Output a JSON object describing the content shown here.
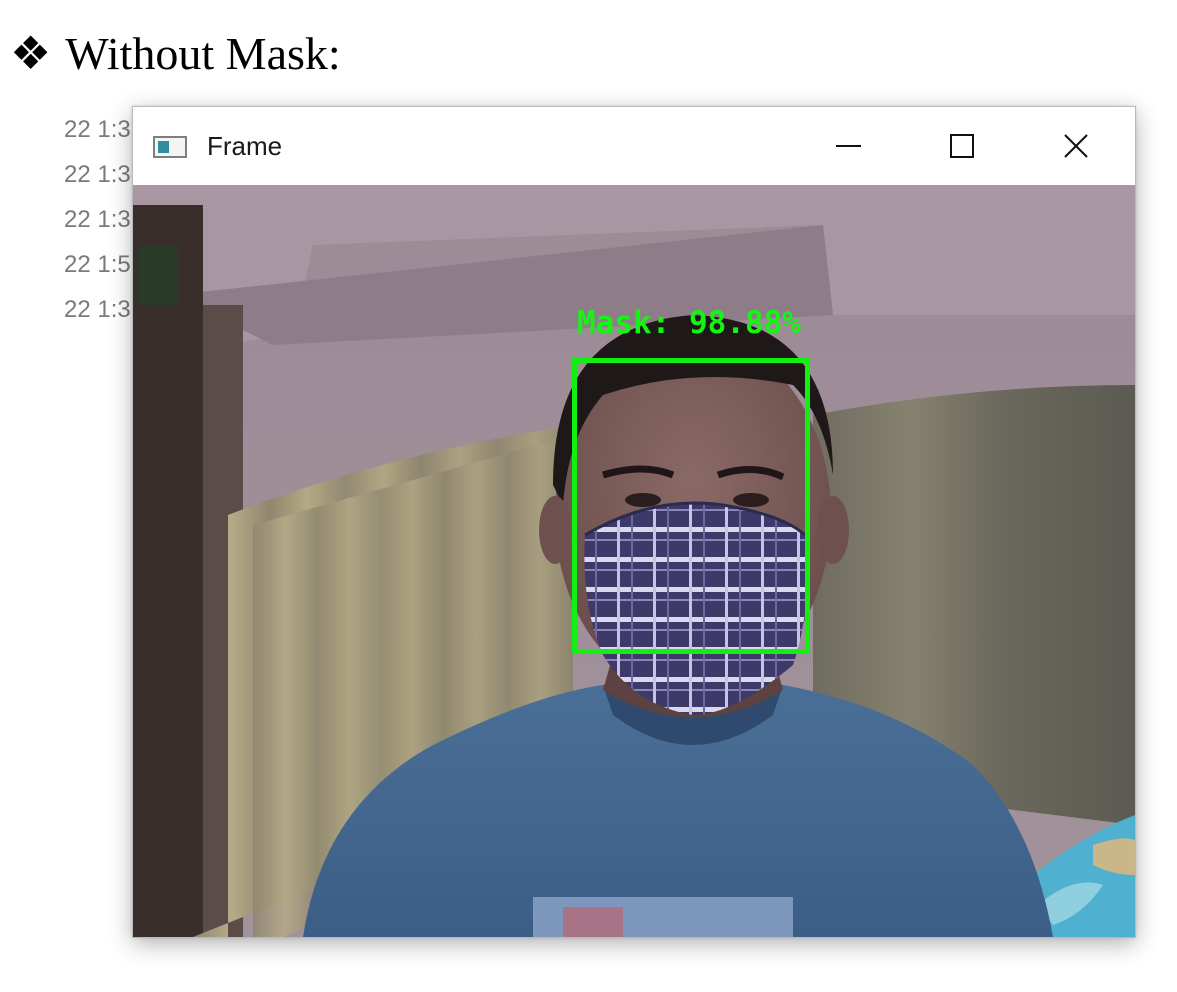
{
  "heading": {
    "bullet": "❖",
    "text": "Without Mask:"
  },
  "background_window": {
    "rows": [
      "22 1:3",
      "22 1:3",
      "22 1:3",
      "22 1:5",
      "22 1:3"
    ]
  },
  "window": {
    "title": "Frame",
    "icon": "opencv-window-icon",
    "controls": [
      "minimize-icon",
      "maximize-icon",
      "close-icon"
    ]
  },
  "detection": {
    "label": "Mask: 98.88%",
    "box_color": "#12f012"
  }
}
